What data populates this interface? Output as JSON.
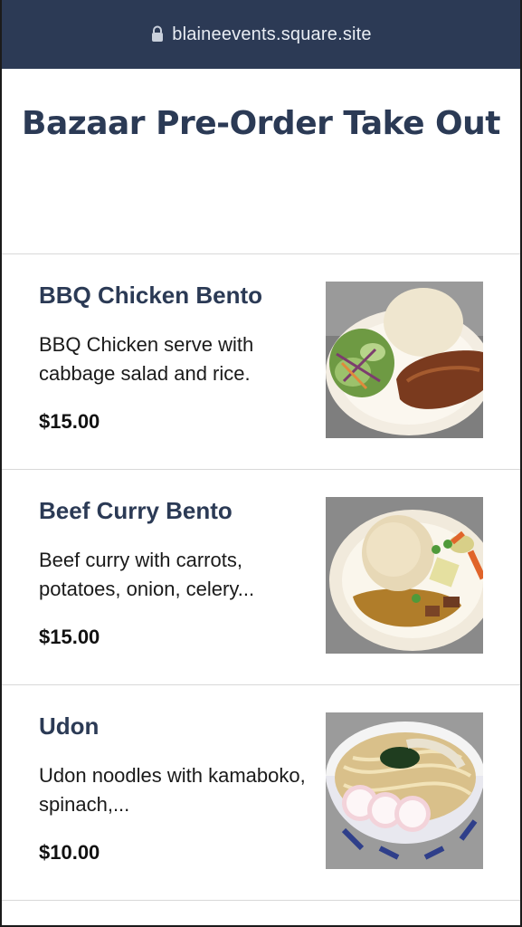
{
  "browser": {
    "url": "blaineevents.square.site",
    "lock_icon": "lock-icon"
  },
  "page": {
    "title": "Bazaar Pre-Order Take Out"
  },
  "items": [
    {
      "name": "BBQ Chicken Bento",
      "description": "BBQ Chicken serve with cabbage salad and rice.",
      "price": "$15.00"
    },
    {
      "name": "Beef Curry Bento",
      "description": "Beef curry with carrots, potatoes, onion, celery...",
      "price": "$15.00"
    },
    {
      "name": "Udon",
      "description": "Udon noodles with kamaboko, spinach,...",
      "price": "$10.00"
    }
  ]
}
